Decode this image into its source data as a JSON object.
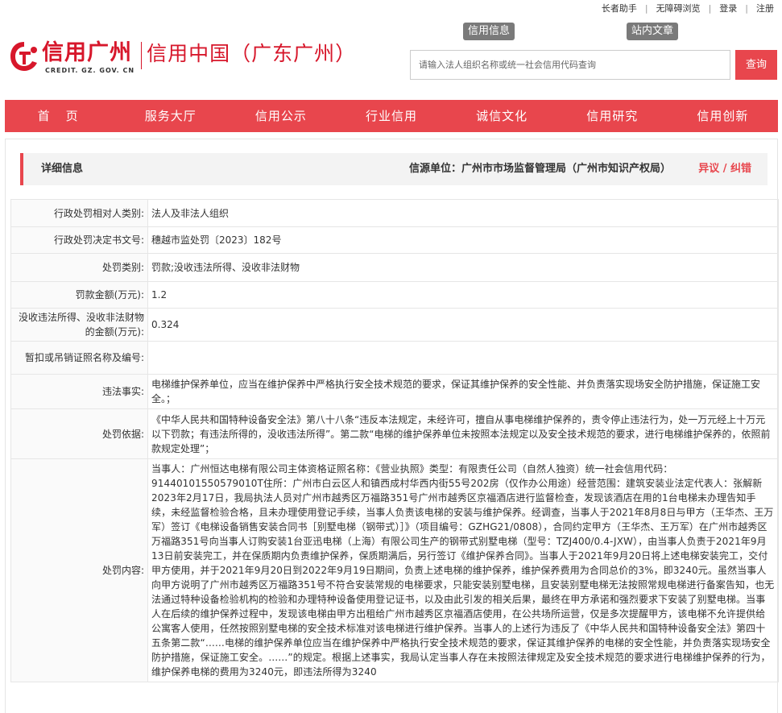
{
  "topbar": {
    "elder": "长者助手",
    "access": "无障碍浏览",
    "login": "登录",
    "register": "注册"
  },
  "logo": {
    "cn": "信用广州",
    "url": "CREDIT. GZ. GOV. CN",
    "sub": "信用中国（广东广州）"
  },
  "search": {
    "tab_info": "信用信息",
    "tab_articles": "站内文章",
    "placeholder": "请输入法人组织名称或统一社会信用代码查询",
    "button": "查询"
  },
  "nav": [
    "首页",
    "服务大厅",
    "信用公示",
    "行业信用",
    "诚信文化",
    "信用研究",
    "信用创新"
  ],
  "detail": {
    "title": "详细信息",
    "source": "信源单位：广州市市场监督管理局（广州市知识产权局）",
    "objection": "异议 / 纠错"
  },
  "colors": {
    "accent": "#e8464d",
    "brand": "#d7172b"
  },
  "rows": [
    {
      "label": "行政处罚相对人类别:",
      "value": "法人及非法人组织"
    },
    {
      "label": "行政处罚决定书文号:",
      "value": "穗越市监处罚〔2023〕182号"
    },
    {
      "label": "处罚类别:",
      "value": "罚款;没收违法所得、没收非法财物"
    },
    {
      "label": "罚款金额(万元):",
      "value": "1.2"
    },
    {
      "label": "没收违法所得、没收非法财物的金额(万元):",
      "value": "0.324"
    },
    {
      "label": "暂扣或吊销证照名称及编号:",
      "value": ""
    },
    {
      "label": "违法事实:",
      "value": "电梯维护保养单位，应当在维护保养中严格执行安全技术规范的要求，保证其维护保养的安全性能、并负责落实现场安全防护措施，保证施工安全。；"
    },
    {
      "label": "处罚依据:",
      "value": "《中华人民共和国特种设备安全法》第八十八条“违反本法规定，未经许可，擅自从事电梯维护保养的，责令停止违法行为，处一万元经上十万元以下罚款；有违法所得的，没收违法所得”。第二款“电梯的维护保养单位未按照本法规定以及安全技术规范的要求，进行电梯维护保养的，依照前款规定处理”；"
    },
    {
      "label": "处罚内容:",
      "value": "当事人：广州恒达电梯有限公司主体资格证照名称：《营业执照》类型：有限责任公司（自然人独资）统一社会信用代码：91440101550579010T住所：广州市白云区人和镇西成村华西内街55号202房（仅作办公用途）经营范围：建筑安装业法定代表人：张解新2023年2月17日，我局执法人员对广州市越秀区万福路351号广州市越秀区京福酒店进行监督检查，发现该酒店在用的1台电梯未办理告知手续，未经监督检验合格，且未办理使用登记手续，当事人负责该电梯的安装与维护保养。经调查，当事人于2021年8月8日与甲方（王华杰、王万军）签订《电梯设备销售安装合同书［别墅电梯（钢带式）］》（项目编号：GZHG21/0808），合同约定甲方（王华杰、王万军）在广州市越秀区万福路351号向当事人订购安装1台亚迅电梯（上海）有限公司生产的钢带式别墅电梯（型号：TZJ400/0.4-JXW），由当事人负责于2021年9月13日前安装完工，并在保质期内负责维护保养，保质期满后，另行签订《维护保养合同》。当事人于2021年9月20日将上述电梯安装完工，交付甲方使用，并于2021年9月20日到2022年9月19日期间，负责上述电梯的维护保养，维护保养费用为合同总价的3%，即3240元。虽然当事人向甲方说明了广州市越秀区万福路351号不符合安装常规的电梯要求，只能安装别墅电梯，且安装别墅电梯无法按照常规电梯进行备案告知，也无法通过特种设备检验机构的检验和办理特种设备使用登记证书，以及由此引发的相关后果，最终在甲方承诺和强烈要求下安装了别墅电梯。当事人在后续的维护保养过程中，发现该电梯由甲方出租给广州市越秀区京福酒店使用，在公共场所运营，仅是多次提醒甲方，该电梯不允许提供给公寓客人使用，任然按照别墅电梯的安全技术标准对该电梯进行维护保养。当事人的上述行为违反了《中华人民共和国特种设备安全法》第四十五条第二款“……电梯的维护保养单位应当在维护保养中严格执行安全技术规范的要求，保证其维护保养的电梯的安全性能，并负责落实现场安全防护措施，保证施工安全。……”的规定。根据上述事实，我局认定当事人存在未按照法律规定及安全技术规范的要求进行电梯维护保养的行为，维护保养电梯的费用为3240元，即违法所得为3240"
    }
  ]
}
